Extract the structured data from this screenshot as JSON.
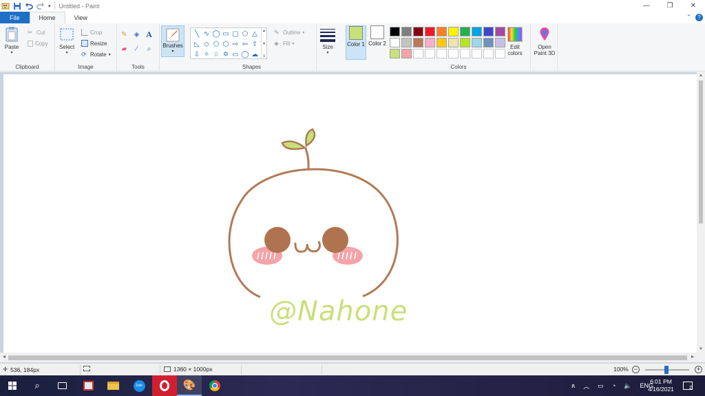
{
  "window": {
    "title": "Untitled - Paint",
    "controls": {
      "minimize": "—",
      "maximize": "❐",
      "close": "✕"
    }
  },
  "tabs": [
    {
      "label": "File"
    },
    {
      "label": "Home"
    },
    {
      "label": "View"
    }
  ],
  "ribbon": {
    "clipboard": {
      "paste": "Paste",
      "cut": "Cut",
      "copy": "Copy",
      "label": "Clipboard"
    },
    "image": {
      "select": "Select",
      "crop": "Crop",
      "resize": "Resize",
      "rotate": "Rotate",
      "label": "Image"
    },
    "tools": {
      "label": "Tools"
    },
    "brushes": {
      "label": "Brushes"
    },
    "shapes": {
      "outline": "Outline",
      "fill": "Fill",
      "label": "Shapes"
    },
    "size": {
      "label": "Size"
    },
    "colors": {
      "color1_label": "Color 1",
      "color2_label": "Color 2",
      "color1": "#c8e07a",
      "color2": "#ffffff",
      "edit_colors": "Edit colors",
      "label": "Colors",
      "palette": [
        "#000000",
        "#7f7f7f",
        "#880015",
        "#ed1c24",
        "#ff7f27",
        "#fff200",
        "#22b14c",
        "#00a2e8",
        "#3f48cc",
        "#a349a4",
        "#ffffff",
        "#c3c3c3",
        "#b97a57",
        "#ffaec9",
        "#ffc90e",
        "#efe4b0",
        "#b5e61d",
        "#99d9ea",
        "#7092be",
        "#c8bfe7",
        "#c8e07a",
        "#f4a4a8",
        "#ffffff",
        "#ffffff",
        "#ffffff",
        "#ffffff",
        "#ffffff",
        "#ffffff",
        "#ffffff",
        "#ffffff"
      ]
    },
    "paint3d": {
      "label": "Open Paint 3D"
    }
  },
  "drawing": {
    "signature": "@Nahone",
    "outline_color": "#b07a55",
    "cheek_color": "#f4a4a8",
    "eye_color": "#b07350",
    "leaf_color": "#c8e07a"
  },
  "status": {
    "cursor_pos": "536, 184px",
    "canvas_size": "1360 × 1000px",
    "zoom": "100%"
  },
  "taskbar": {
    "lang": "ENG",
    "time": "6:01 PM",
    "date": "4/16/2021",
    "notifications": "2"
  }
}
